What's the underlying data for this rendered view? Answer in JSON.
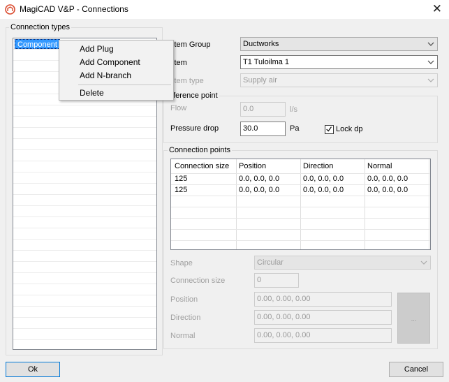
{
  "window": {
    "title": "MagiCAD V&P - Connections",
    "icon": "magicad-app-icon",
    "close_icon": "close-icon"
  },
  "connection_types": {
    "group_label": "Connection types",
    "items": [
      "Component"
    ]
  },
  "context_menu": {
    "items": [
      "Add Plug",
      "Add Component",
      "Add N-branch"
    ],
    "delete_label": "Delete"
  },
  "system": {
    "system_group_label": "stem Group",
    "system_group_value": "Ductworks",
    "system_label": "stem",
    "system_value": "T1  Tuloilma 1",
    "system_type_label": "stem type",
    "system_type_value": "Supply air"
  },
  "reference_point": {
    "group_label": "eference point",
    "flow_label": "Flow",
    "flow_value": "0.0",
    "flow_unit": "l/s",
    "pressure_drop_label": "Pressure drop",
    "pressure_drop_value": "30.0",
    "pressure_drop_unit": "Pa",
    "lock_dp_label": "Lock dp",
    "lock_dp_checked": true
  },
  "connection_points": {
    "group_label": "Connection points",
    "columns": [
      "Connection size",
      "Position",
      "Direction",
      "Normal"
    ],
    "rows": [
      [
        "125",
        "0.0, 0.0, 0.0",
        "0.0, 0.0, 0.0",
        "0.0, 0.0, 0.0"
      ],
      [
        "125",
        "0.0, 0.0, 0.0",
        "0.0, 0.0, 0.0",
        "0.0, 0.0, 0.0"
      ]
    ],
    "shape_label": "Shape",
    "shape_value": "Circular",
    "connection_size_label": "Connection size",
    "connection_size_value": "0",
    "position_label": "Position",
    "position_value": "0.00, 0.00, 0.00",
    "direction_label": "Direction",
    "direction_value": "0.00, 0.00, 0.00",
    "normal_label": "Normal",
    "normal_value": "0.00, 0.00, 0.00",
    "pick_button_label": "..."
  },
  "buttons": {
    "ok": "Ok",
    "cancel": "Cancel"
  }
}
